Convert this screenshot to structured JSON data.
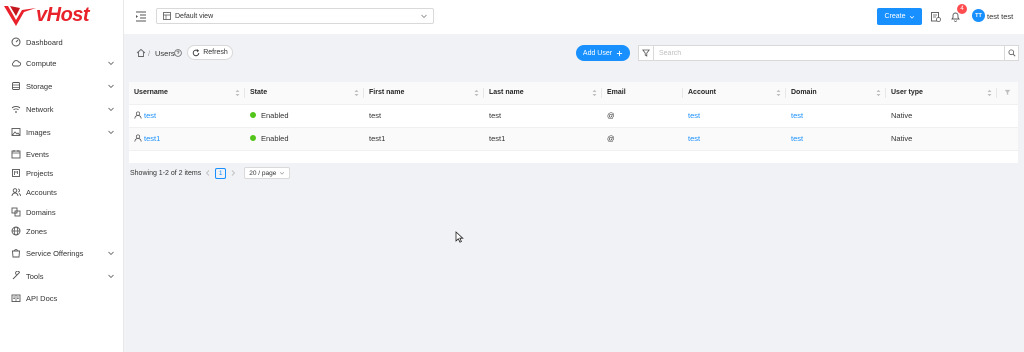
{
  "brand": {
    "name": "vHost",
    "color": "#e8212a",
    "accent": "#1890ff"
  },
  "sidebar": {
    "items": [
      {
        "label": "Dashboard",
        "icon": "dashboard-icon",
        "expandable": false
      },
      {
        "label": "Compute",
        "icon": "cloud-icon",
        "expandable": true
      },
      {
        "label": "Storage",
        "icon": "database-icon",
        "expandable": true
      },
      {
        "label": "Network",
        "icon": "wifi-icon",
        "expandable": true
      },
      {
        "label": "Images",
        "icon": "picture-icon",
        "expandable": true
      },
      {
        "label": "Events",
        "icon": "schedule-icon",
        "expandable": false
      },
      {
        "label": "Projects",
        "icon": "project-icon",
        "expandable": false
      },
      {
        "label": "Accounts",
        "icon": "team-icon",
        "expandable": false
      },
      {
        "label": "Domains",
        "icon": "block-icon",
        "expandable": false
      },
      {
        "label": "Zones",
        "icon": "global-icon",
        "expandable": false
      },
      {
        "label": "Service Offerings",
        "icon": "shopping-icon",
        "expandable": true
      },
      {
        "label": "Tools",
        "icon": "tool-icon",
        "expandable": true
      },
      {
        "label": "API Docs",
        "icon": "read-icon",
        "expandable": false
      }
    ]
  },
  "header": {
    "view_select": "Default view",
    "create_label": "Create",
    "notification_count": "4",
    "avatar_initials": "TT",
    "user_name": "test test"
  },
  "breadcrumb": {
    "separator": "/",
    "current": "Users",
    "refresh_label": "Refresh"
  },
  "toolbar": {
    "add_label": "Add User",
    "search_placeholder": "Search"
  },
  "table": {
    "columns": [
      "Username",
      "State",
      "First name",
      "Last name",
      "Email",
      "Account",
      "Domain",
      "User type"
    ],
    "rows": [
      {
        "username": "test",
        "state": "Enabled",
        "first_name": "test",
        "last_name": "test",
        "email": "@",
        "account": "test",
        "domain": "test",
        "user_type": "Native"
      },
      {
        "username": "test1",
        "state": "Enabled",
        "first_name": "test1",
        "last_name": "test1",
        "email": "@",
        "account": "test",
        "domain": "test",
        "user_type": "Native"
      }
    ]
  },
  "pagination": {
    "summary": "Showing 1-2 of 2 items",
    "current_page": "1",
    "page_size": "20 / page"
  }
}
